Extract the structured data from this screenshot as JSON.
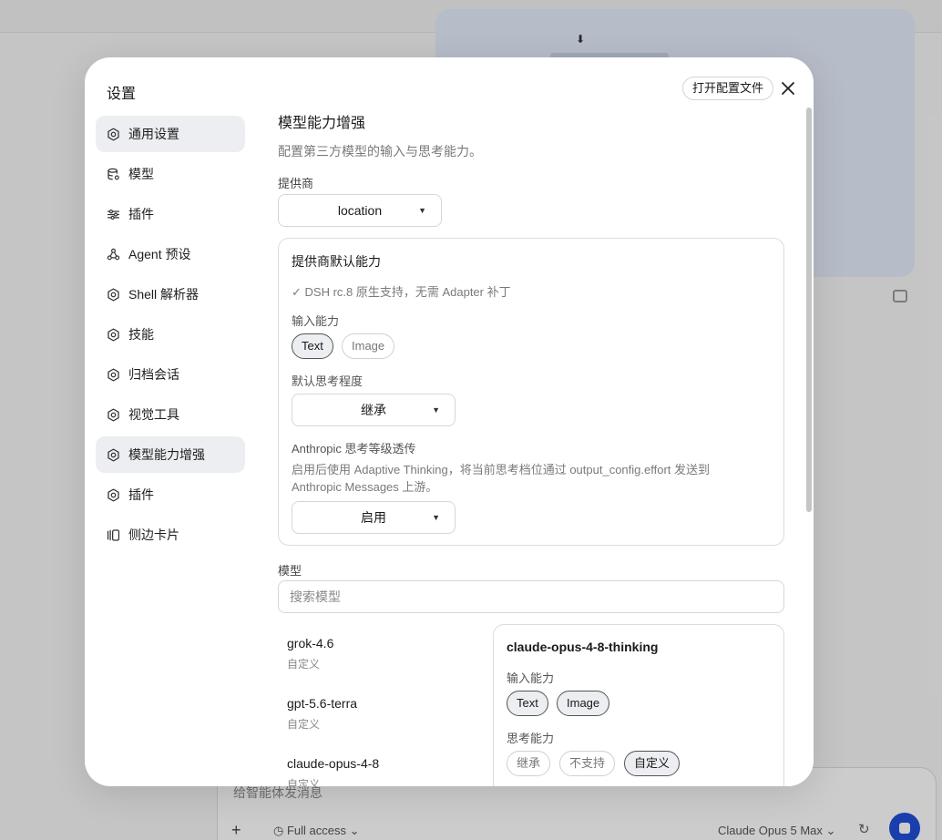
{
  "background": {
    "composer_placeholder": "给智能体发消息",
    "access_label": "Full access",
    "model_label": "Claude Opus 5 Max"
  },
  "modal": {
    "title": "设置",
    "open_config_label": "打开配置文件",
    "close_icon": "close-icon"
  },
  "sidebar": {
    "items": [
      {
        "label": "通用设置",
        "icon": "gear-icon",
        "active": true
      },
      {
        "label": "模型",
        "icon": "database-icon"
      },
      {
        "label": "插件",
        "icon": "sliders-icon"
      },
      {
        "label": "Agent 预设",
        "icon": "agent-icon"
      },
      {
        "label": "Shell 解析器",
        "icon": "gear-icon"
      },
      {
        "label": "技能",
        "icon": "gear-icon"
      },
      {
        "label": "归档会话",
        "icon": "gear-icon"
      },
      {
        "label": "视觉工具",
        "icon": "gear-icon"
      },
      {
        "label": "模型能力增强",
        "icon": "gear-icon",
        "active": true
      },
      {
        "label": "插件",
        "icon": "gear-icon"
      },
      {
        "label": "侧边卡片",
        "icon": "sidecard-icon"
      }
    ]
  },
  "content": {
    "title": "模型能力增强",
    "description": "配置第三方模型的输入与思考能力。",
    "provider_label": "提供商",
    "provider_value": "location",
    "provider_panel": {
      "title": "提供商默认能力",
      "note": "✓ DSH rc.8 原生支持，无需 Adapter 补丁",
      "input_label": "输入能力",
      "input_chips": [
        {
          "label": "Text",
          "selected": true
        },
        {
          "label": "Image",
          "selected": false
        }
      ],
      "thinking_label": "默认思考程度",
      "thinking_value": "继承",
      "anthropic_label": "Anthropic 思考等级透传",
      "anthropic_desc": "启用后使用 Adaptive Thinking，将当前思考档位通过 output_config.effort 发送到 Anthropic Messages 上游。",
      "anthropic_value": "启用"
    },
    "models_label": "模型",
    "search_placeholder": "搜索模型",
    "models": [
      {
        "name": "grok-4.6",
        "sub": "自定义"
      },
      {
        "name": "gpt-5.6-terra",
        "sub": "自定义"
      },
      {
        "name": "claude-opus-4-8",
        "sub": "自定义"
      }
    ],
    "detail": {
      "title": "claude-opus-4-8-thinking",
      "input_label": "输入能力",
      "input_chips": [
        {
          "label": "Text",
          "selected": true
        },
        {
          "label": "Image",
          "selected": true
        }
      ],
      "thinking_label": "思考能力",
      "thinking_chips": [
        {
          "label": "继承",
          "selected": false
        },
        {
          "label": "不支持",
          "selected": false
        },
        {
          "label": "自定义",
          "selected": true
        }
      ]
    }
  }
}
